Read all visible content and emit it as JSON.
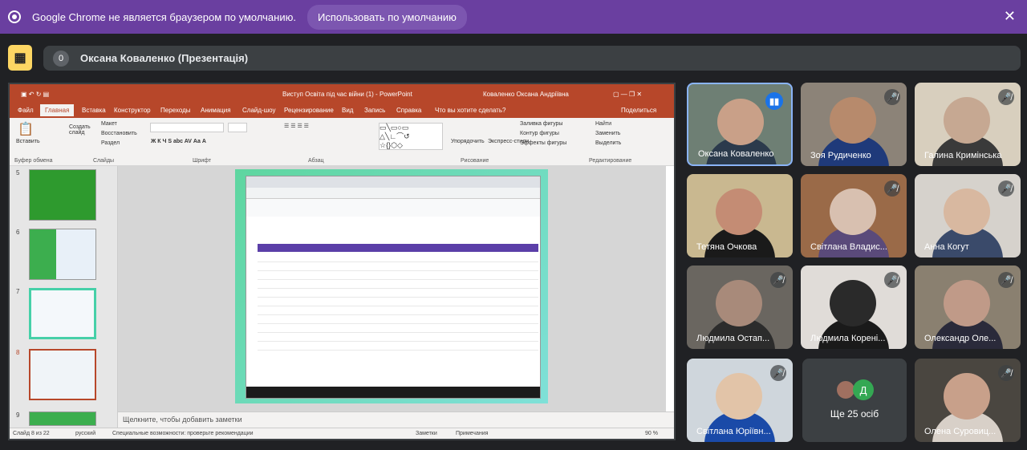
{
  "infobar": {
    "message": "Google Chrome не является браузером по умолчанию.",
    "default_button": "Использовать по умолчанию",
    "close": "✕"
  },
  "presentation": {
    "count": "0",
    "title": "Оксана Коваленко (Презентація)"
  },
  "powerpoint": {
    "doc_title": "Виступ Освіта під час війни (1) - PowerPoint",
    "user": "Коваленко Оксана Андріївна",
    "tabs": [
      "Файл",
      "Главная",
      "Вставка",
      "Конструктор",
      "Переходы",
      "Анимация",
      "Слайд-шоу",
      "Рецензирование",
      "Вид",
      "Запись",
      "Справка"
    ],
    "tell_me": "Что вы хотите сделать?",
    "share": "Поделиться",
    "ribbon": {
      "paste": "Вставить",
      "new_slide": "Создать слайд",
      "layout": "Макет",
      "restore": "Восстановить",
      "section": "Раздел",
      "arrange": "Упорядочить",
      "quick_styles": "Экспресс-стили",
      "shape_fill": "Заливка фигуры",
      "shape_outline": "Контур фигуры",
      "shape_effects": "Эффекты фигуры",
      "find": "Найти",
      "replace": "Заменить",
      "select": "Выделить",
      "groups": [
        "Буфер обмена",
        "Слайды",
        "Шрифт",
        "Абзац",
        "Рисование",
        "Редактирование"
      ]
    },
    "slide_numbers": [
      "5",
      "6",
      "7",
      "8",
      "9"
    ],
    "notes_placeholder": "Щелкните, чтобы добавить заметки",
    "status": {
      "slide": "Слайд 8 из 22",
      "language": "русский",
      "accessibility": "Специальные возможности: проверьте рекомендации",
      "notes": "Заметки",
      "comments": "Примечания",
      "zoom": "90 %"
    }
  },
  "participants": [
    {
      "name": "Оксана Коваленко",
      "speaking": true
    },
    {
      "name": "Зоя Рудиченко",
      "speaking": false
    },
    {
      "name": "Галина Кримінська",
      "speaking": false
    },
    {
      "name": "Тетяна Очкова",
      "speaking": false
    },
    {
      "name": "Світлана Владис...",
      "speaking": false
    },
    {
      "name": "Анна Когут",
      "speaking": false
    },
    {
      "name": "Людмила Остап...",
      "speaking": false
    },
    {
      "name": "Людмила Корені...",
      "speaking": false
    },
    {
      "name": "Олександр Оле...",
      "speaking": false
    },
    {
      "name": "Світлана Юріївн...",
      "speaking": false
    },
    {
      "name": "Олена Суровиц...",
      "speaking": false
    }
  ],
  "more": {
    "avatar_letter": "Д",
    "label": "Ще 25 осіб"
  },
  "colors": {
    "infobar": "#6a3fa0",
    "ppt_red": "#b7472a",
    "meet_bg": "#202124",
    "speak_blue": "#1a73e8"
  }
}
